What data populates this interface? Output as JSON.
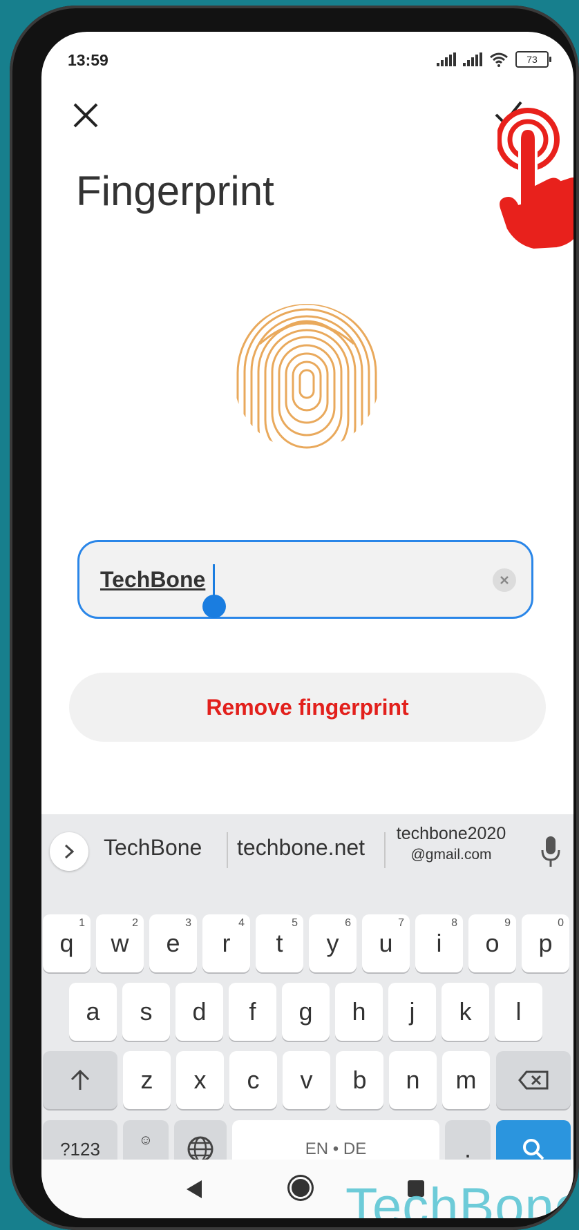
{
  "status_bar": {
    "time": "13:59",
    "battery": "73"
  },
  "header": {
    "close_icon": "close-icon",
    "confirm_icon": "check-icon",
    "title": "Fingerprint"
  },
  "name_field": {
    "value": "TechBone"
  },
  "remove_button": {
    "label": "Remove fingerprint",
    "color": "#e2201c"
  },
  "suggestions": {
    "items": [
      "TechBone",
      "techbone.net"
    ],
    "email": {
      "line1": "techbone2020",
      "line2": "@gmail.com"
    }
  },
  "keyboard": {
    "row1": [
      {
        "k": "q",
        "h": "1"
      },
      {
        "k": "w",
        "h": "2"
      },
      {
        "k": "e",
        "h": "3"
      },
      {
        "k": "r",
        "h": "4"
      },
      {
        "k": "t",
        "h": "5"
      },
      {
        "k": "y",
        "h": "6"
      },
      {
        "k": "u",
        "h": "7"
      },
      {
        "k": "i",
        "h": "8"
      },
      {
        "k": "o",
        "h": "9"
      },
      {
        "k": "p",
        "h": "0"
      }
    ],
    "row2": [
      "a",
      "s",
      "d",
      "f",
      "g",
      "h",
      "j",
      "k",
      "l"
    ],
    "row3": [
      "z",
      "x",
      "c",
      "v",
      "b",
      "n",
      "m"
    ],
    "symbols": "?123",
    "emoji_comma": ",",
    "space": "EN • DE",
    "period": "."
  },
  "watermark": "TechBone",
  "colors": {
    "accent": "#2a86e8",
    "search_key": "#2b95de",
    "fingerprint": "#e9a95c"
  }
}
